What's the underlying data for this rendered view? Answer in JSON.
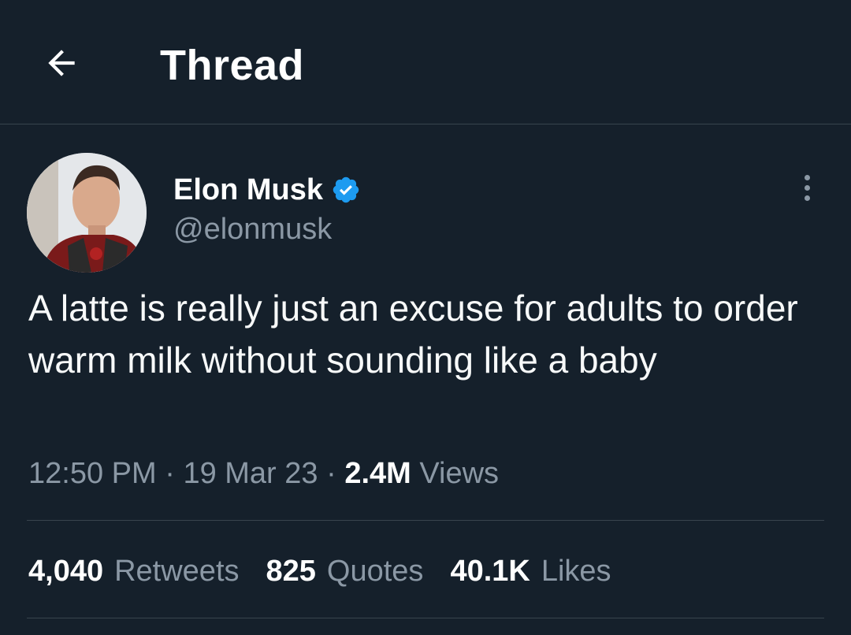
{
  "header": {
    "title": "Thread",
    "back_icon": "arrow-left-icon"
  },
  "tweet": {
    "author": {
      "name": "Elon Musk",
      "handle": "@elonmusk",
      "verified": true,
      "verified_color": "#1d9bf0"
    },
    "text": "A latte is really just an excuse for adults to order warm milk without sounding like a baby",
    "time": "12:50 PM",
    "separator": "·",
    "date": "19 Mar 23",
    "views_count": "2.4M",
    "views_label": "Views",
    "more_icon": "more-vertical-icon"
  },
  "stats": {
    "retweets_count": "4,040",
    "retweets_label": "Retweets",
    "quotes_count": "825",
    "quotes_label": "Quotes",
    "likes_count": "40.1K",
    "likes_label": "Likes"
  },
  "colors": {
    "background": "#15202b",
    "border": "#38444d",
    "secondary_text": "#8b98a5",
    "primary_text": "#ffffff",
    "accent": "#1d9bf0"
  }
}
